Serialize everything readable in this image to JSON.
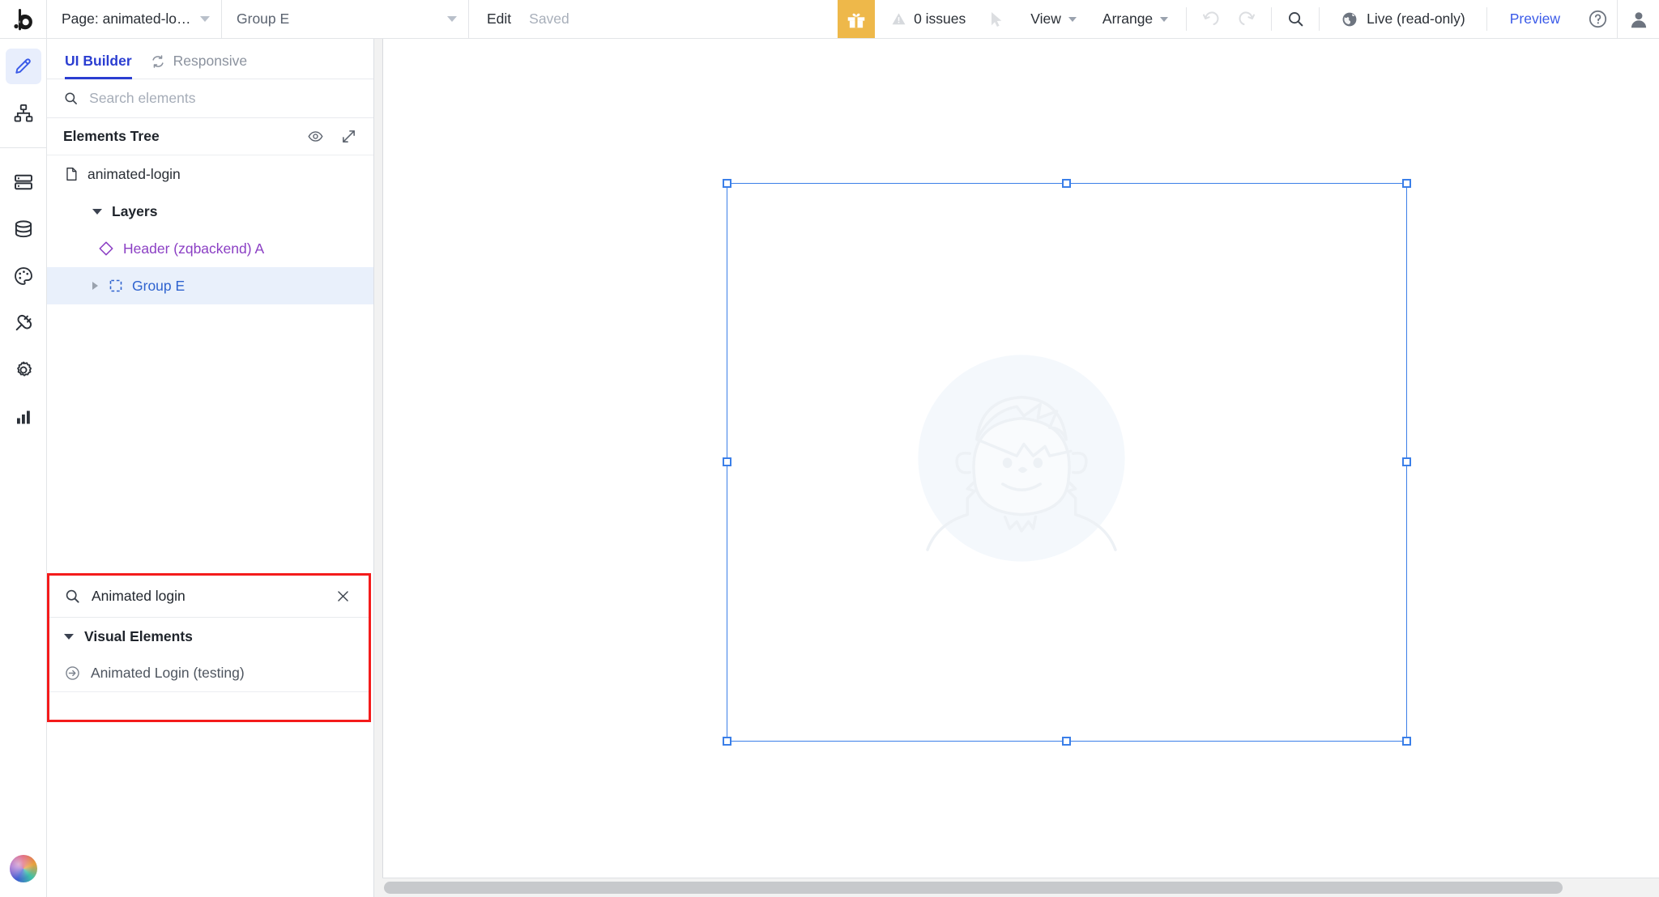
{
  "topbar": {
    "logo_icon": "bubble-b-logo",
    "page_select": {
      "label": "Page: animated-login",
      "caret_icon": "chevron-down-icon"
    },
    "group_select": {
      "label": "Group E",
      "caret_icon": "chevron-down-icon"
    },
    "edit_label": "Edit",
    "saved_label": "Saved",
    "gift_icon": "gift-icon",
    "issues": {
      "icon": "warning-triangle-icon",
      "label": "0 issues"
    },
    "cursor_icon": "mouse-pointer-icon",
    "view_menu": "View",
    "arrange_menu": "Arrange",
    "undo_icon": "undo-icon",
    "redo_icon": "redo-icon",
    "search_icon": "search-icon",
    "live": {
      "icon": "globe-icon",
      "label": "Live (read-only)"
    },
    "preview_label": "Preview",
    "help_icon": "question-circle-icon",
    "avatar_icon": "user-avatar-icon",
    "accent_color": "#3a5ae8",
    "gift_bg_color": "#eeb84a"
  },
  "rail": {
    "items": [
      {
        "name": "design-pencil",
        "icon": "pencil-icon",
        "active": true
      },
      {
        "name": "workflow",
        "icon": "sitemap-icon",
        "active": false
      },
      {
        "name": "data-tables",
        "icon": "rows-layout-icon",
        "active": false
      },
      {
        "name": "database",
        "icon": "database-icon",
        "active": false
      },
      {
        "name": "styles",
        "icon": "palette-icon",
        "active": false
      },
      {
        "name": "plugins",
        "icon": "plug-icon",
        "active": false
      },
      {
        "name": "settings",
        "icon": "gear-icon",
        "active": false
      },
      {
        "name": "logs",
        "icon": "bar-chart-icon",
        "active": false
      }
    ],
    "avatar_icon": "app-avatar-icon"
  },
  "panel": {
    "tabs": [
      {
        "label": "UI Builder",
        "active": true,
        "icon": null
      },
      {
        "label": "Responsive",
        "active": false,
        "icon": "sync-arrows-icon"
      }
    ],
    "search": {
      "value": "",
      "placeholder": "Search elements",
      "icon": "search-icon"
    },
    "tree_header": {
      "title": "Elements Tree",
      "eye_icon": "eye-icon",
      "expand_icon": "expand-diagonal-icon"
    },
    "tree": [
      {
        "label": "animated-login",
        "icon": "file-icon",
        "style": "doc",
        "indent": 0,
        "caret": null,
        "selected": false
      },
      {
        "label": "Layers",
        "icon": null,
        "style": "bold",
        "indent": 1,
        "caret": "down",
        "selected": false
      },
      {
        "label": "Header (zqbackend) A",
        "icon": "diamond-icon",
        "style": "purple",
        "indent": 2,
        "caret": null,
        "selected": false
      },
      {
        "label": "Group E",
        "icon": "dashed-square-icon",
        "style": "blue",
        "indent": 2,
        "caret": "right",
        "selected": true
      }
    ]
  },
  "popup": {
    "highlight_color": "#f41b1b",
    "search": {
      "value": "Animated login",
      "placeholder": "Search elements",
      "icon": "search-icon",
      "clear_icon": "close-x-icon"
    },
    "group": {
      "label": "Visual Elements",
      "caret_icon": "caret-down-icon",
      "expanded": true
    },
    "items": [
      {
        "label": "Animated Login (testing)",
        "icon": "login-arrow-icon"
      }
    ]
  },
  "canvas": {
    "watermark_icon": "placeholder-avatar-illustration",
    "selection": {
      "color": "#3b7fe8",
      "handles": [
        "top-left",
        "top-center",
        "top-right",
        "middle-left",
        "middle-right",
        "bottom-left",
        "bottom-center",
        "bottom-right"
      ]
    },
    "scrollbar": "horizontal-scrollbar"
  }
}
